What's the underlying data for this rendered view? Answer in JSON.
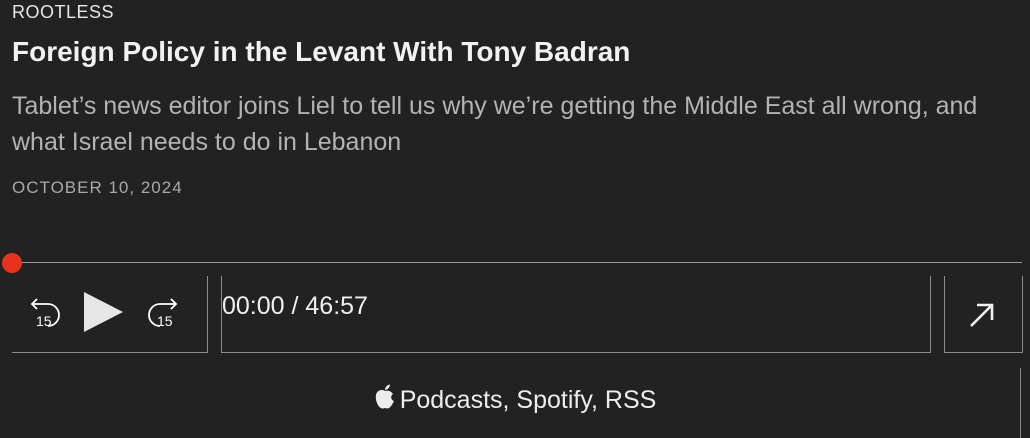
{
  "episode": {
    "show": "ROOTLESS",
    "title": "Foreign Policy in the Levant With Tony Badran",
    "description": "Tablet’s news editor joins Liel to tell us why we’re getting the Middle East all wrong, and what Israel needs to do in Lebanon",
    "date": "OCTOBER 10, 2024"
  },
  "player": {
    "skip_back_label": "15",
    "skip_forward_label": "15",
    "time": "00:00 / 46:57",
    "progress_fraction": 0.0,
    "accent_color": "#e8331c",
    "icons": [
      "skip-back-15-icon",
      "play-icon",
      "skip-forward-15-icon",
      "share-arrow-icon",
      "apple-icon"
    ]
  },
  "platforms": {
    "label": "Podcasts, Spotify, RSS"
  }
}
